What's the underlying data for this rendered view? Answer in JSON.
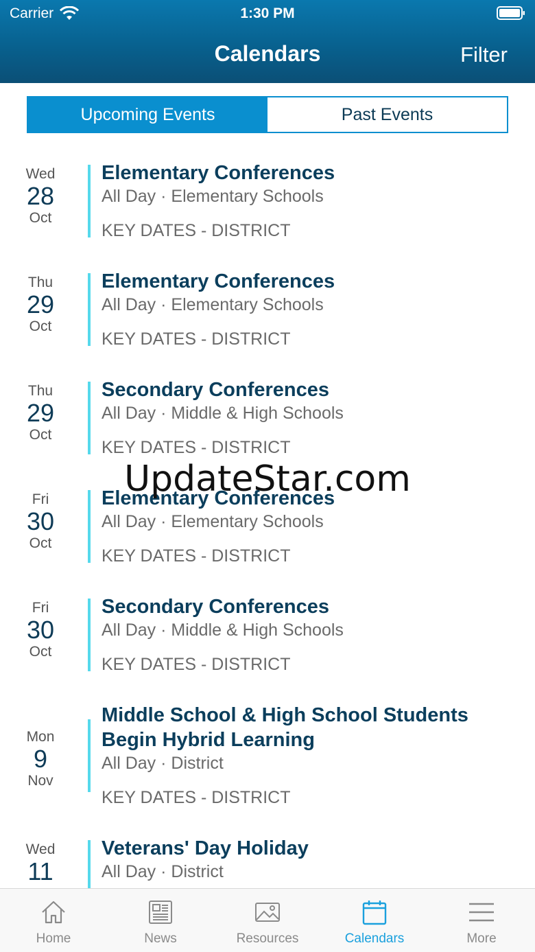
{
  "status_bar": {
    "carrier": "Carrier",
    "time": "1:30 PM"
  },
  "header": {
    "title": "Calendars",
    "filter_label": "Filter"
  },
  "segments": {
    "upcoming": "Upcoming Events",
    "past": "Past Events"
  },
  "events": [
    {
      "dow": "Wed",
      "day": "28",
      "month": "Oct",
      "title": "Elementary Conferences",
      "meta": "All Day · Elementary Schools",
      "calendar": "KEY DATES - DISTRICT"
    },
    {
      "dow": "Thu",
      "day": "29",
      "month": "Oct",
      "title": "Elementary Conferences",
      "meta": "All Day · Elementary Schools",
      "calendar": "KEY DATES - DISTRICT"
    },
    {
      "dow": "Thu",
      "day": "29",
      "month": "Oct",
      "title": "Secondary Conferences",
      "meta": "All Day · Middle & High Schools",
      "calendar": "KEY DATES - DISTRICT"
    },
    {
      "dow": "Fri",
      "day": "30",
      "month": "Oct",
      "title": "Elementary Conferences",
      "meta": "All Day · Elementary Schools",
      "calendar": "KEY DATES - DISTRICT"
    },
    {
      "dow": "Fri",
      "day": "30",
      "month": "Oct",
      "title": "Secondary Conferences",
      "meta": "All Day · Middle & High Schools",
      "calendar": "KEY DATES - DISTRICT"
    },
    {
      "dow": "Mon",
      "day": "9",
      "month": "Nov",
      "title_line1": "Middle School & High School Students",
      "title_line2": "Begin Hybrid Learning",
      "meta": "All Day · District",
      "calendar": "KEY DATES - DISTRICT"
    },
    {
      "dow": "Wed",
      "day": "11",
      "title": "Veterans' Day Holiday",
      "meta": "All Day · District"
    }
  ],
  "watermark": "UpdateStar.com",
  "tabs": [
    {
      "label": "Home",
      "icon": "home-icon"
    },
    {
      "label": "News",
      "icon": "newspaper-icon"
    },
    {
      "label": "Resources",
      "icon": "image-icon"
    },
    {
      "label": "Calendars",
      "icon": "calendar-icon",
      "active": true
    },
    {
      "label": "More",
      "icon": "menu-icon"
    }
  ],
  "colors": {
    "header": "#0a6a9c",
    "accent": "#0a8fcf",
    "event_bar": "#56d9ec",
    "title_text": "#0b3e5c",
    "tab_active": "#1aa0dd"
  }
}
